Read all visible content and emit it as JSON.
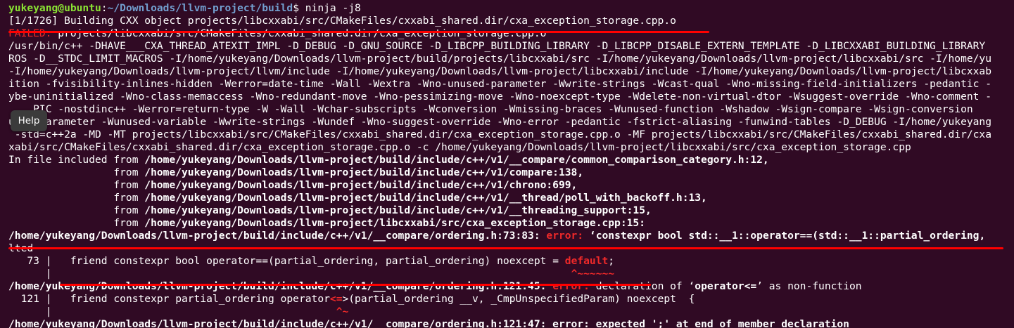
{
  "terminal": {
    "prompt_user": "yukeyang@ubuntu",
    "prompt_sep": ":",
    "prompt_path": "~/Downloads/llvm-project/build",
    "prompt_dollar": "$ ",
    "command": "ninja -j8",
    "build_status": "[1/1726] Building CXX object projects/libcxxabi/src/CMakeFiles/cxxabi_shared.dir/cxa_exception_storage.cpp.o",
    "failed_label": "FAILED:",
    "failed_target": " projects/libcxxabi/src/CMakeFiles/cxxabi_shared.dir/cxa_exception_storage.cpp.o",
    "cmd_lines": [
      "/usr/bin/c++ -DHAVE___CXA_THREAD_ATEXIT_IMPL -D_DEBUG -D_GNU_SOURCE -D_LIBCPP_BUILDING_LIBRARY -D_LIBCPP_DISABLE_EXTERN_TEMPLATE -D_LIBCXXABI_BUILDING_LIBRARY",
      "ROS -D__STDC_LIMIT_MACROS -I/home/yukeyang/Downloads/llvm-project/build/projects/libcxxabi/src -I/home/yukeyang/Downloads/llvm-project/libcxxabi/src -I/home/yu",
      "-I/home/yukeyang/Downloads/llvm-project/llvm/include -I/home/yukeyang/Downloads/llvm-project/libcxxabi/include -I/home/yukeyang/Downloads/llvm-project/libcxxab",
      "ition -fvisibility-inlines-hidden -Werror=date-time -Wall -Wextra -Wno-unused-parameter -Wwrite-strings -Wcast-qual -Wno-missing-field-initializers -pedantic -",
      "ybe-uninitialized -Wno-class-memaccess -Wno-redundant-move -Wno-pessimizing-move -Wno-noexcept-type -Wdelete-non-virtual-dtor -Wsuggest-override -Wno-comment -",
      "    PIC -nostdinc++ -Werror=return-type -W -Wall -Wchar-subscripts -Wconversion -Wmissing-braces -Wunused-function -Wshadow -Wsign-compare -Wsign-conversion",
      "used-parameter -Wunused-variable -Wwrite-strings -Wundef -Wno-suggest-override -Wno-error -pedantic -fstrict-aliasing -funwind-tables -D_DEBUG -I/home/yukeyang",
      " -std=c++2a -MD -MT projects/libcxxabi/src/CMakeFiles/cxxabi_shared.dir/cxa_exception_storage.cpp.o -MF projects/libcxxabi/src/CMakeFiles/cxxabi_shared.dir/cxa",
      "xabi/src/CMakeFiles/cxxabi_shared.dir/cxa_exception_storage.cpp.o -c /home/yukeyang/Downloads/llvm-project/libcxxabi/src/cxa_exception_storage.cpp"
    ],
    "include_first_prefix": "In file included from ",
    "include_from_prefix": "                 from ",
    "include_paths": [
      "/home/yukeyang/Downloads/llvm-project/build/include/c++/v1/__compare/common_comparison_category.h:12,",
      "/home/yukeyang/Downloads/llvm-project/build/include/c++/v1/compare:138,",
      "/home/yukeyang/Downloads/llvm-project/build/include/c++/v1/chrono:699,",
      "/home/yukeyang/Downloads/llvm-project/build/include/c++/v1/__thread/poll_with_backoff.h:13,",
      "/home/yukeyang/Downloads/llvm-project/build/include/c++/v1/__threading_support:15,",
      "/home/yukeyang/Downloads/llvm-project/libcxxabi/src/cxa_exception_storage.cpp:15:"
    ],
    "error1": {
      "location": "/home/yukeyang/Downloads/llvm-project/build/include/c++/v1/__compare/ordering.h:73:83:",
      "label": " error:",
      "message": " ‘constexpr bool std::__1::operator==(std::__1::partial_ordering,",
      "wrap": "lted"
    },
    "code1": {
      "gutter": "   73 |   ",
      "before": "friend constexpr bool operator==(partial_ordering, partial_ordering) noexcept = ",
      "highlight": "default",
      "after": ";"
    },
    "marker1": {
      "gutter": "      |   ",
      "pad": "                                                                                 ",
      "carets": "^~~~~~~"
    },
    "error2": {
      "location": "/home/yukeyang/Downloads/llvm-project/build/include/c++/v1/__compare/ordering.h:121:45:",
      "label": " error:",
      "message_pre": " declaration of ‘",
      "message_bold": "operator<=",
      "message_post": "’ as non-function"
    },
    "code2": {
      "gutter": "  121 |   ",
      "before": "friend constexpr partial_ordering operator",
      "highlight": "<=",
      "after": ">(partial_ordering __v, _CmpUnspecifiedParam) noexcept  {"
    },
    "marker2": {
      "gutter": "      |   ",
      "pad": "                                           ",
      "carets": "^~"
    },
    "cut_line": "/home/yukeyang/Downloads/llvm-project/build/include/c++/v1/__compare/ordering.h:121:47: error: expected ';' at end of member declaration"
  },
  "tooltip": {
    "label": "Help"
  },
  "colors": {
    "background": "#300a24",
    "prompt_user": "#8ae234",
    "prompt_path": "#729fcf",
    "error": "#ef2929",
    "annotation_underline": "#ff0000"
  }
}
